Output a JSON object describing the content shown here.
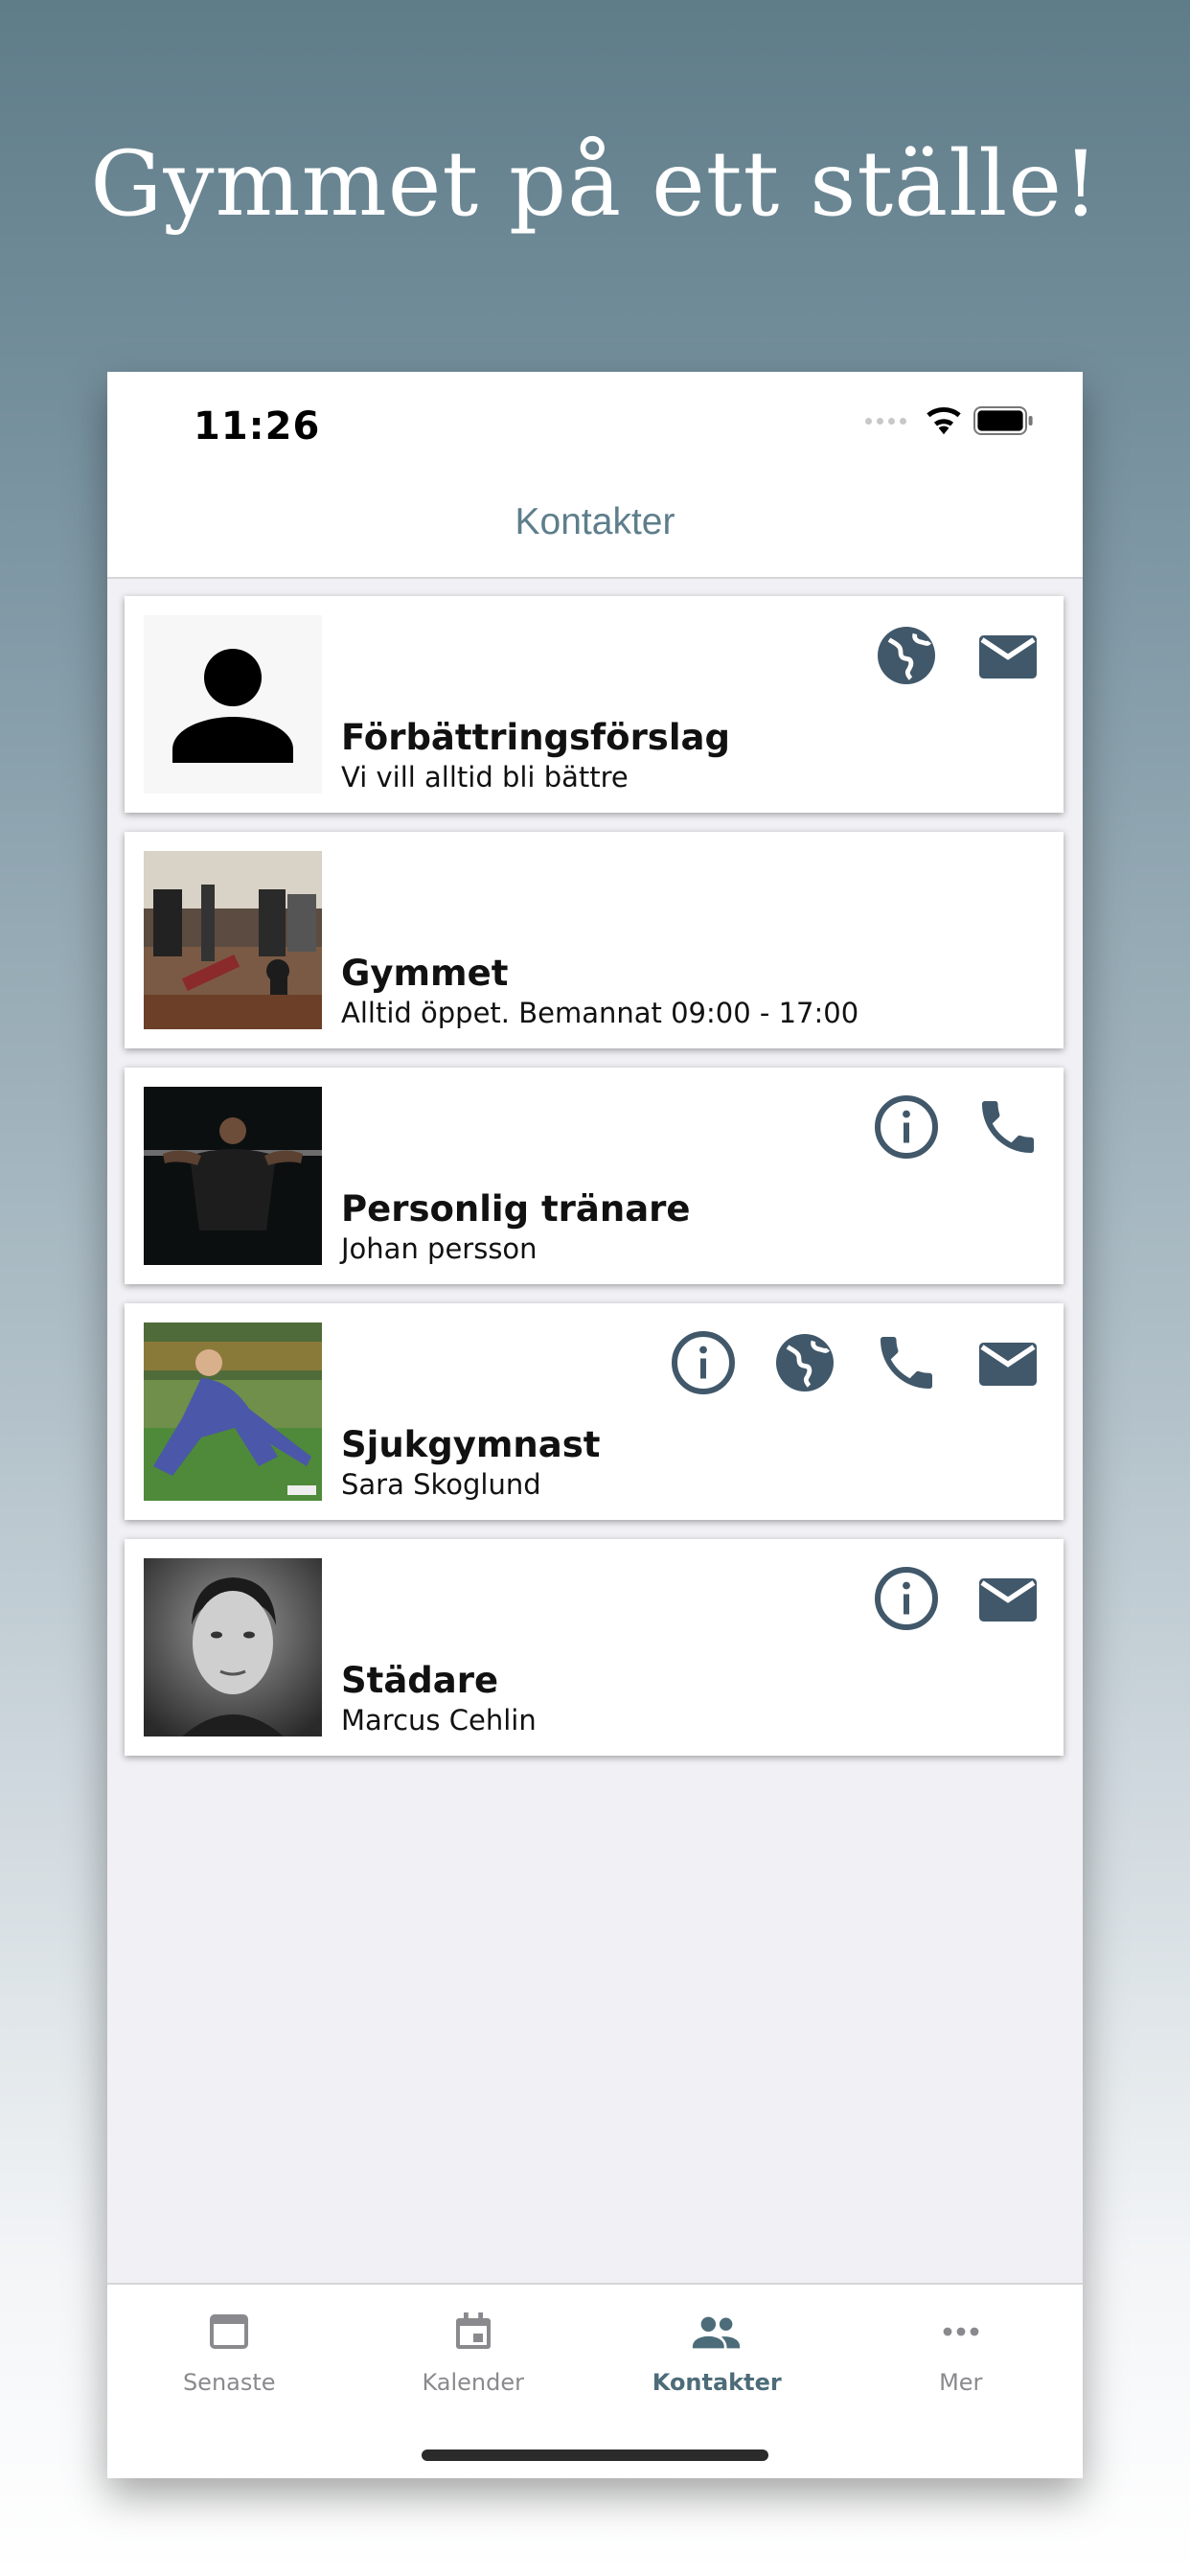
{
  "headline": "Gymmet på ett ställe!",
  "status_bar": {
    "time": "11:26"
  },
  "nav": {
    "title": "Kontakter"
  },
  "contacts": [
    {
      "title": "Förbättringsförslag",
      "subtitle": "Vi vill alltid bli bättre",
      "image": "person-placeholder",
      "actions": [
        "globe-icon",
        "mail-icon"
      ]
    },
    {
      "title": "Gymmet",
      "subtitle": "Alltid öppet. Bemannat 09:00 - 17:00",
      "image": "gym-photo",
      "actions": []
    },
    {
      "title": "Personlig tränare",
      "subtitle": "Johan persson",
      "image": "trainer-photo",
      "actions": [
        "info-icon",
        "phone-icon"
      ]
    },
    {
      "title": "Sjukgymnast",
      "subtitle": "Sara Skoglund",
      "image": "physio-photo",
      "actions": [
        "info-icon",
        "globe-icon",
        "phone-icon",
        "mail-icon"
      ]
    },
    {
      "title": "Städare",
      "subtitle": "Marcus Cehlin",
      "image": "cleaner-photo",
      "actions": [
        "info-icon",
        "mail-icon"
      ]
    }
  ],
  "tabbar": {
    "tabs": [
      {
        "label": "Senaste",
        "icon": "window-icon",
        "active": false
      },
      {
        "label": "Kalender",
        "icon": "calendar-icon",
        "active": false
      },
      {
        "label": "Kontakter",
        "icon": "people-icon",
        "active": true
      },
      {
        "label": "Mer",
        "icon": "more-icon",
        "active": false
      }
    ]
  },
  "colors": {
    "accent": "#4d6c79",
    "icon": "#41586a",
    "inactive": "#8a8a8e"
  }
}
